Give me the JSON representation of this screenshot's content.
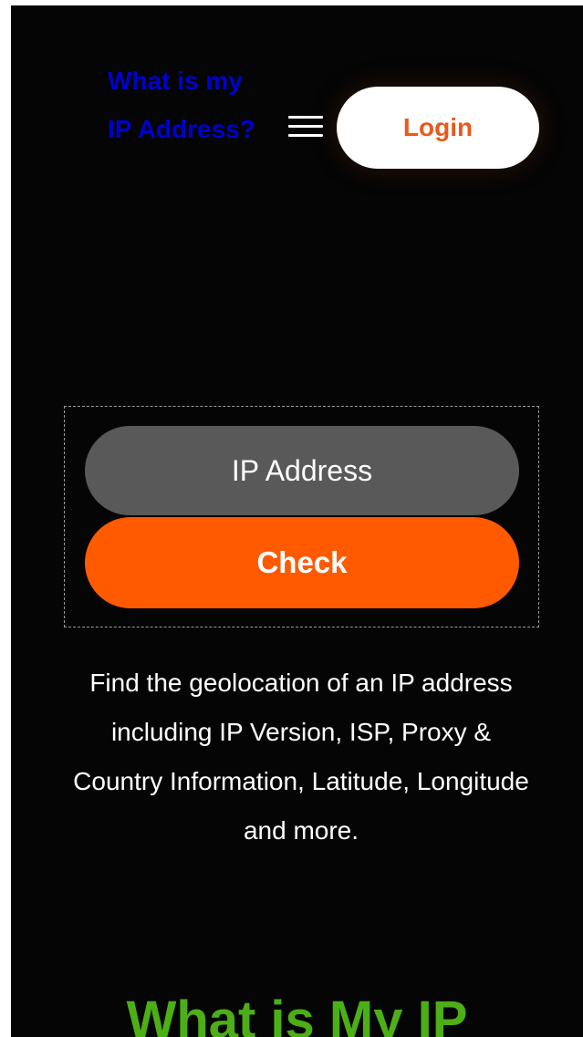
{
  "header": {
    "site_title": "What is my IP Address?",
    "login_label": "Login"
  },
  "icons": {
    "menu": "hamburger-menu-icon"
  },
  "lookup": {
    "input_placeholder": "IP Address",
    "input_value": "",
    "check_label": "Check"
  },
  "description": "Find the geolocation of an IP address including IP Version, ISP, Proxy & Country Information, Latitude, Longitude and more.",
  "section": {
    "heading": "What is My IP"
  },
  "colors": {
    "background": "#050505",
    "site_title": "#0000cc",
    "accent_orange": "#ff5a00",
    "login_text": "#e85a1c",
    "input_background": "#595959",
    "heading_green": "#4caf16"
  }
}
